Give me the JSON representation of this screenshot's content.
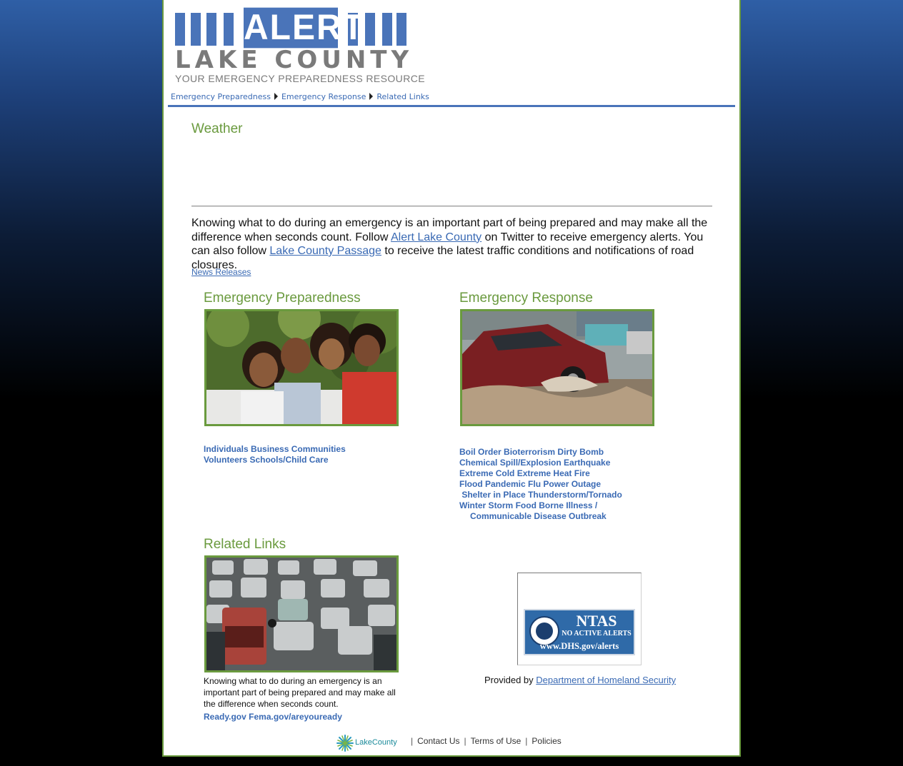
{
  "logo": {
    "alert_word": "ALERT",
    "county": "LAKE COUNTY",
    "tagline": "YOUR EMERGENCY PREPAREDNESS RESOURCE"
  },
  "nav": {
    "items": [
      "Emergency Preparedness",
      "Emergency Response",
      "Related Links"
    ]
  },
  "weather": {
    "title": "Weather"
  },
  "intro": {
    "part1": "Knowing what to do during an emergency is an important part of being prepared and may make all the difference when seconds count. Follow ",
    "link1": "Alert Lake County",
    "part2": " on Twitter to receive emergency alerts. You can also follow ",
    "link2": "Lake County Passage",
    "part3": " to receive the latest traffic conditions and notifications of road closures."
  },
  "news_link": "News Releases",
  "preparedness": {
    "title": "Emergency Preparedness",
    "links": [
      "Individuals",
      "Business",
      "Communities",
      "Volunteers",
      "Schools/Child Care"
    ]
  },
  "response": {
    "title": "Emergency Response",
    "links": [
      "Boil Order",
      "Bioterrorism",
      "Dirty Bomb",
      "Chemical Spill/Explosion",
      "Earthquake",
      "Extreme Cold",
      "Extreme Heat",
      "Fire",
      "Flood",
      "Pandemic Flu",
      "Power Outage",
      "Shelter in Place",
      "Thunderstorm/Tornado",
      "Winter Storm",
      "Food Borne Illness /",
      "Communicable Disease Outbreak"
    ]
  },
  "related": {
    "title": "Related Links",
    "text": "Knowing what to do during an emergency is an important part of being prepared and may make all the difference when seconds count.",
    "links": [
      "Ready.gov",
      "Fema.gov/areyouready"
    ]
  },
  "ntas": {
    "title": "NTAS",
    "subtitle": "NO ACTIVE ALERTS",
    "url": "www.DHS.gov/alerts",
    "provided_prefix": "Provided by ",
    "provided_link": "Department of Homeland Security"
  },
  "footer": {
    "logo_text": "LakeCounty",
    "links": [
      "Contact Us",
      "Terms of Use",
      "Policies"
    ],
    "separator": "|"
  },
  "colors": {
    "accent_blue": "#4a74b9",
    "heading_green": "#6a9a3e",
    "link_blue": "#3a6ab4",
    "logo_gray": "#7a7a7a"
  }
}
